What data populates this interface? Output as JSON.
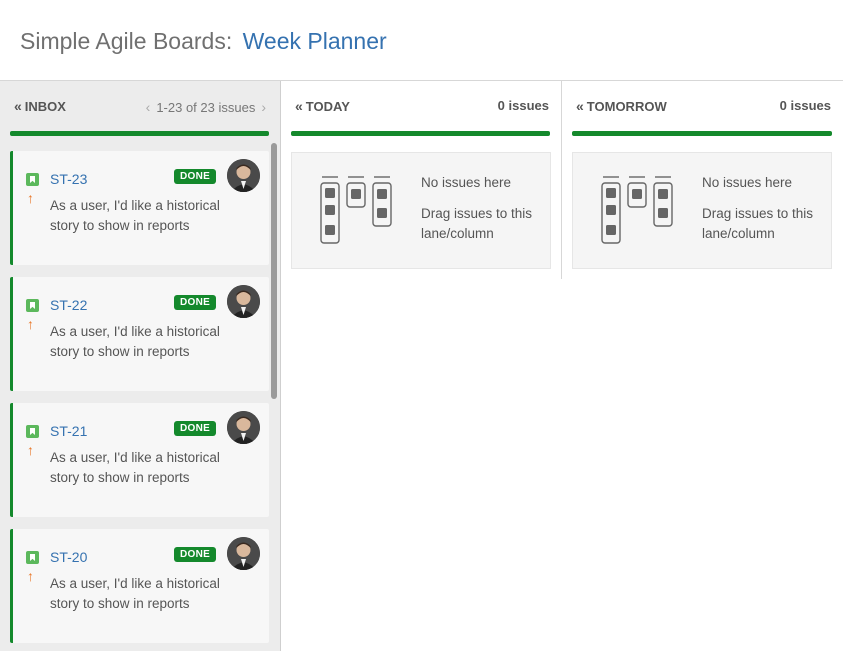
{
  "header": {
    "app_title": "Simple Agile Boards:",
    "board_name": "Week Planner"
  },
  "columns": [
    {
      "title": "INBOX",
      "pager": "1-23 of 23 issues",
      "cards": [
        {
          "key": "ST-23",
          "status": "DONE",
          "summary": "As a user, I'd like a historical story to show in reports"
        },
        {
          "key": "ST-22",
          "status": "DONE",
          "summary": "As a user, I'd like a historical story to show in reports"
        },
        {
          "key": "ST-21",
          "status": "DONE",
          "summary": "As a user, I'd like a historical story to show in reports"
        },
        {
          "key": "ST-20",
          "status": "DONE",
          "summary": "As a user, I'd like a historical story to show in reports"
        }
      ]
    },
    {
      "title": "TODAY",
      "count": "0 issues",
      "empty_title": "No issues here",
      "empty_hint": "Drag issues to this lane/column"
    },
    {
      "title": "TOMORROW",
      "count": "0 issues",
      "empty_title": "No issues here",
      "empty_hint": "Drag issues to this lane/column"
    }
  ],
  "icons": {
    "collapse": "double-chevron-left-icon",
    "prev": "chevron-left-icon",
    "next": "chevron-right-icon",
    "issue_type": "story-bookmark-icon",
    "priority": "priority-up-arrow-icon",
    "avatar": "user-avatar"
  },
  "colors": {
    "accent_green": "#14892c",
    "link_blue": "#3572b0",
    "priority_orange": "#e8782a",
    "story_green": "#5cb85c"
  }
}
